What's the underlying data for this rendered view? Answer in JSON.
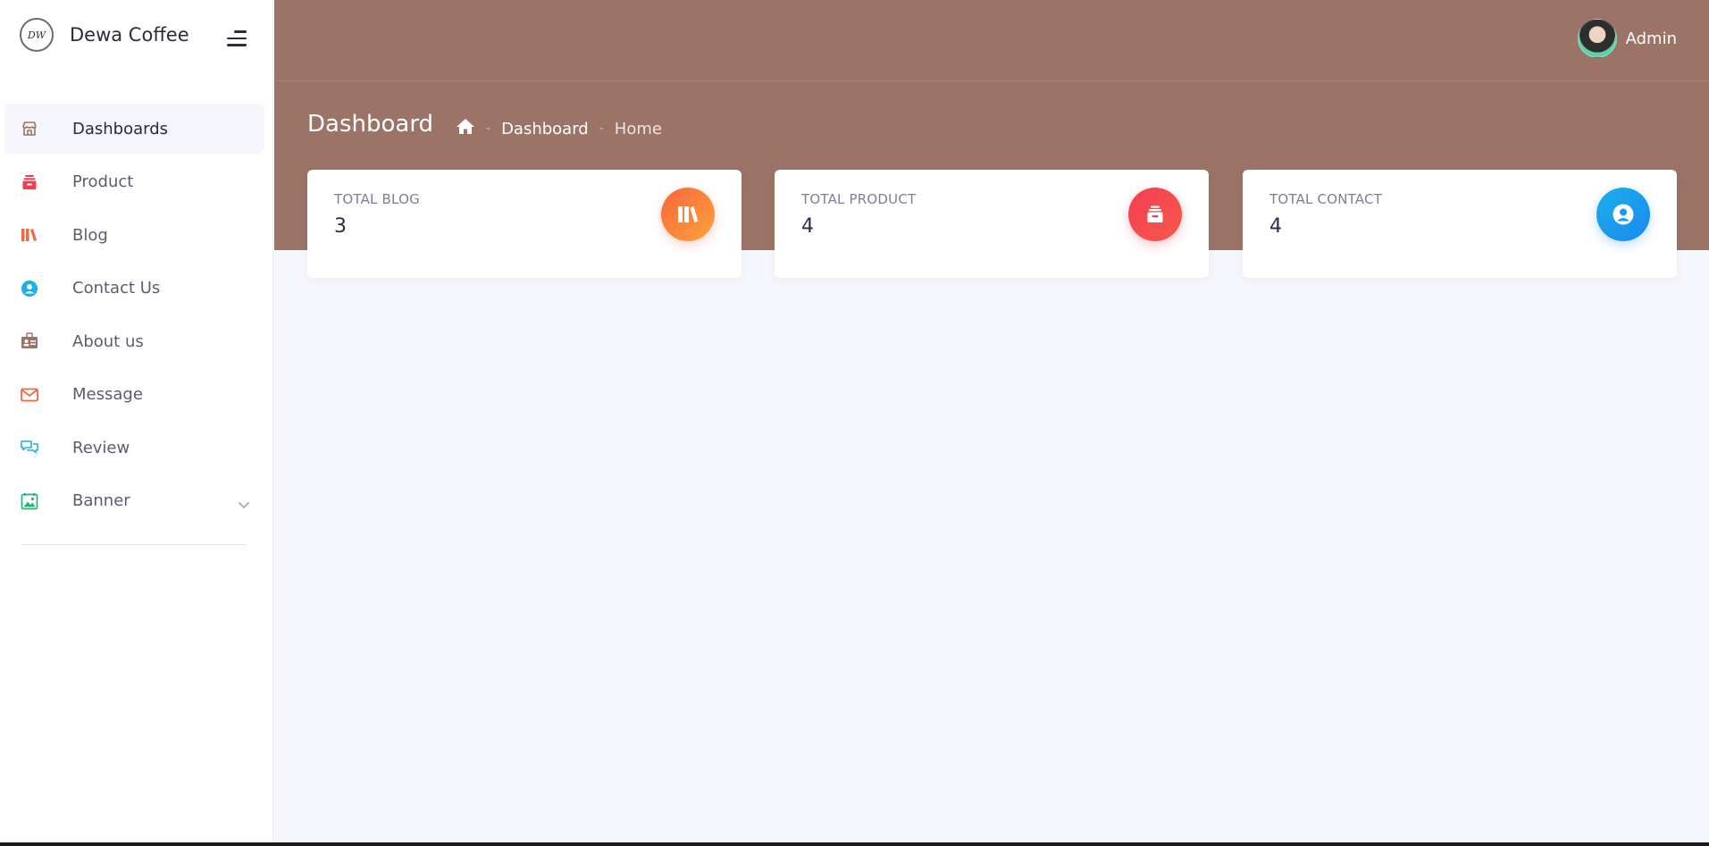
{
  "brand": {
    "name": "Dewa Coffee",
    "logo_text": "DW"
  },
  "sidebar": {
    "items": [
      {
        "label": "Dashboards",
        "icon": "store-icon",
        "active": true
      },
      {
        "label": "Product",
        "icon": "archive-icon"
      },
      {
        "label": "Blog",
        "icon": "books-icon"
      },
      {
        "label": "Contact Us",
        "icon": "user-circle-icon"
      },
      {
        "label": "About us",
        "icon": "id-card-icon"
      },
      {
        "label": "Message",
        "icon": "envelope-icon"
      },
      {
        "label": "Review",
        "icon": "chat-bubbles-icon"
      },
      {
        "label": "Banner",
        "icon": "image-icon",
        "has_submenu": true
      }
    ]
  },
  "header": {
    "user_name": "Admin"
  },
  "page": {
    "title": "Dashboard",
    "breadcrumb": {
      "item1": "Dashboard",
      "item2": "Home"
    }
  },
  "cards": [
    {
      "label": "TOTAL BLOG",
      "value": "3",
      "icon": "books-icon",
      "color": "#f7663c"
    },
    {
      "label": "TOTAL PRODUCT",
      "value": "4",
      "icon": "archive-icon",
      "color": "#f23d51"
    },
    {
      "label": "TOTAL CONTACT",
      "value": "4",
      "icon": "user-circle-icon",
      "color": "#1a9cf0"
    }
  ],
  "colors": {
    "hero": "#9b7367",
    "page_background": "#f5f7fc",
    "sidebar_background": "#ffffff"
  }
}
